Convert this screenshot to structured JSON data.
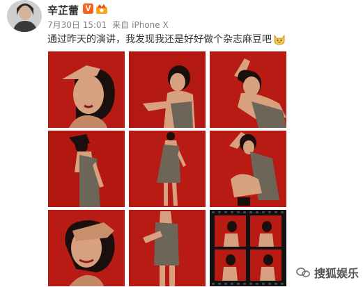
{
  "author": {
    "name": "辛芷蕾",
    "vip_badge": "V"
  },
  "meta": {
    "date": "7月30日 15:01",
    "source_prefix": "来自",
    "source": "iPhone X"
  },
  "post": {
    "text": "通过昨天的演讲，我发现我还是好好做个杂志麻豆吧",
    "emoji_icon": "cat-emoji-icon"
  },
  "photos": [
    {
      "row": 1,
      "col": 1,
      "subject": "close-up, hand on forehead"
    },
    {
      "row": 1,
      "col": 2,
      "subject": "crouching, arms crossed"
    },
    {
      "row": 1,
      "col": 3,
      "subject": "lying, hands raised"
    },
    {
      "row": 2,
      "col": 1,
      "subject": "standing, grey dress"
    },
    {
      "row": 2,
      "col": 2,
      "subject": "full body, grey dress"
    },
    {
      "row": 2,
      "col": 3,
      "subject": "seated, arm on head"
    },
    {
      "row": 3,
      "col": 1,
      "subject": "close-up, hand over eyes"
    },
    {
      "row": 3,
      "col": 2,
      "subject": "standing, grey dress"
    },
    {
      "row": 3,
      "col": 3,
      "subject": "film strip collage"
    }
  ],
  "watermark": {
    "text": "搜狐娱乐"
  },
  "colors": {
    "photo_red": "#b81a14",
    "dress_grey": "#6d6658",
    "skin": "#d7a07e",
    "hair": "#1a0f0c",
    "vip_orange": "#f26522"
  }
}
